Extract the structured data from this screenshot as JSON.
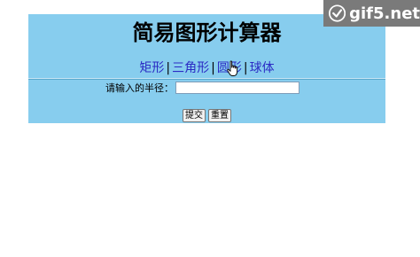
{
  "app": {
    "title": "简易图形计算器"
  },
  "nav": {
    "items": [
      {
        "label": "矩形"
      },
      {
        "label": "三角形"
      },
      {
        "label": "圆形"
      },
      {
        "label": "球体"
      }
    ],
    "separator": "|"
  },
  "form": {
    "radius_label": "请输入的半径：",
    "radius_value": "",
    "submit_label": "提交",
    "reset_label": "重置"
  },
  "watermark": {
    "text": "gif5.net"
  },
  "colors": {
    "panel_bg": "#87cdee",
    "link": "#2b2bc4",
    "watermark_bg": "#7a7a7a"
  },
  "icons": {
    "cursor": "hand-pointer-icon",
    "watermark_logo": "gif5-logo-icon"
  }
}
